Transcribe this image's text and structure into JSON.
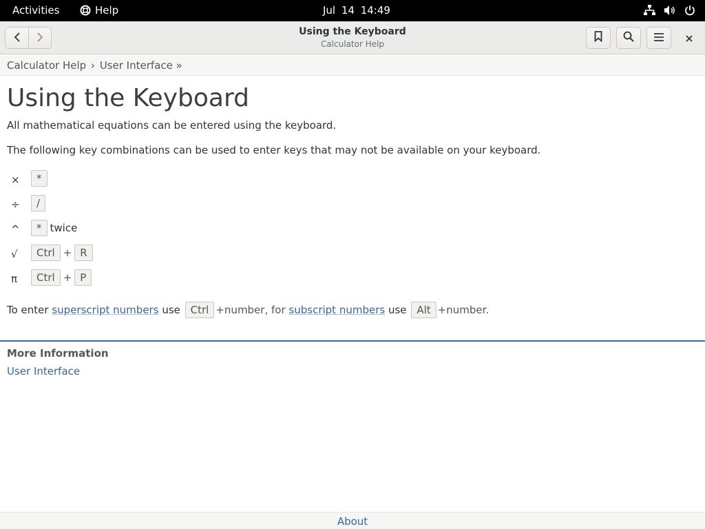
{
  "topbar": {
    "activities": "Activities",
    "app_name": "Help",
    "clock": "Jul 14  14:49"
  },
  "header": {
    "title": "Using the Keyboard",
    "subtitle": "Calculator Help"
  },
  "breadcrumb": {
    "item1": "Calculator Help",
    "sep1": "›",
    "item2": "User Interface",
    "sep2": "»"
  },
  "page": {
    "title": "Using the Keyboard",
    "intro": "All mathematical equations can be entered using the keyboard.",
    "combos_intro": "The following key combinations can be used to enter keys that may not be available on your keyboard.",
    "rows": [
      {
        "symbol": "×",
        "key1": "*"
      },
      {
        "symbol": "÷",
        "key1": "/"
      },
      {
        "symbol": "^",
        "key1": "*",
        "suffix": "twice"
      },
      {
        "symbol": "√",
        "key1": "Ctrl",
        "plus": "+",
        "key2": "R"
      },
      {
        "symbol": "π",
        "key1": "Ctrl",
        "plus": "+",
        "key2": "P"
      }
    ],
    "final": {
      "t1": "To enter",
      "link1": "superscript numbers",
      "t2": "use",
      "key1": "Ctrl",
      "t3": "+number, for",
      "link2": "subscript numbers",
      "t4": "use",
      "key2": "Alt",
      "t5": "+number."
    }
  },
  "more_info": {
    "title": "More Information",
    "link": "User Interface"
  },
  "footer": {
    "about": "About"
  }
}
